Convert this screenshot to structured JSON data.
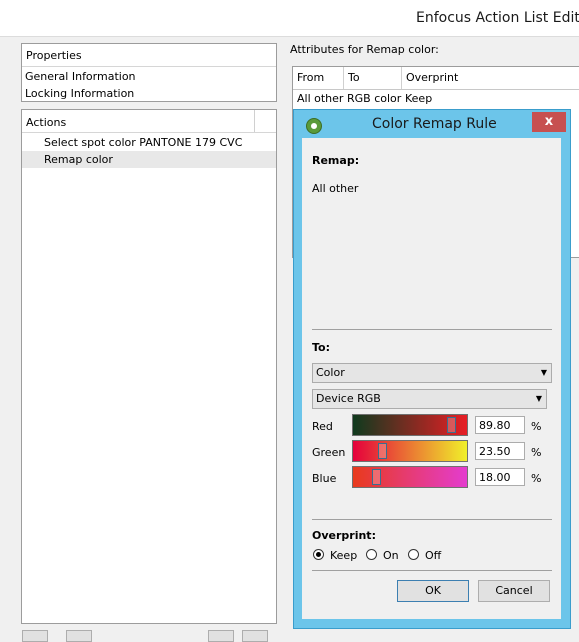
{
  "window": {
    "title": "Enfocus Action List Editor"
  },
  "properties": {
    "header": "Properties",
    "items": [
      "General Information",
      "Locking Information"
    ]
  },
  "actions": {
    "header": "Actions",
    "items": [
      "Select spot color PANTONE 179 CVC",
      "Remap color"
    ]
  },
  "attributes": {
    "label": "Attributes for Remap color:",
    "columns": [
      "From",
      "To",
      "Overprint"
    ],
    "row": [
      "All other",
      "RGB color",
      "Keep"
    ]
  },
  "dialog": {
    "title": "Color Remap Rule",
    "close_label": "x",
    "remap_label": "Remap:",
    "remap_value": "All other",
    "to_label": "To:",
    "to_select": "Color",
    "colorspace_select": "Device RGB",
    "channels": [
      {
        "name": "Red",
        "value": "89.80",
        "unit": "%",
        "level": 0.898
      },
      {
        "name": "Green",
        "value": "23.50",
        "unit": "%",
        "level": 0.235
      },
      {
        "name": "Blue",
        "value": "18.00",
        "unit": "%",
        "level": 0.18
      }
    ],
    "overprint_label": "Overprint:",
    "overprint_options": [
      "Keep",
      "On",
      "Off"
    ],
    "overprint_selected": "Keep",
    "ok_label": "OK",
    "cancel_label": "Cancel"
  },
  "colors": {
    "dialog_frame": "#6cc5ea",
    "close_button": "#c75050"
  }
}
